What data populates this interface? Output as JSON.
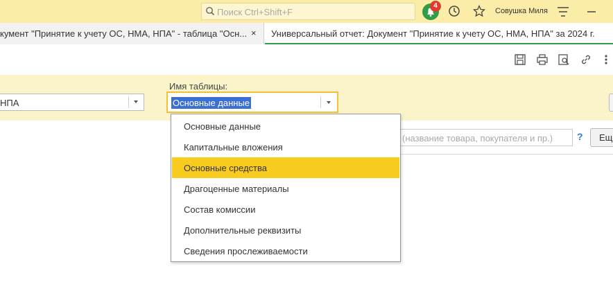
{
  "topbar": {
    "search_placeholder": "Поиск Ctrl+Shift+F",
    "notifications_count": "4",
    "user_name": "Совушка Миля"
  },
  "tabs": [
    {
      "label": "кумент \"Принятие к учету ОС, НМА, НПА\" - таблица \"Осн...",
      "close": "×"
    },
    {
      "label": "Универсальный отчет: Документ \"Принятие к учету ОС, НМА, НПА\" за 2024 г."
    }
  ],
  "filters": {
    "left_field_value": "НПА",
    "table_name_label": "Имя таблицы:",
    "table_name_value": "Основные данные"
  },
  "search": {
    "placeholder": "(название товара, покупателя и пр.)",
    "help": "?",
    "more_label": "Ещё"
  },
  "dropdown": {
    "items": [
      "Основные данные",
      "Капитальные вложения",
      "Основные средства",
      "Драгоценные материалы",
      "Состав комиссии",
      "Дополнительные реквизиты",
      "Сведения прослеживаемости"
    ],
    "highlighted": "Основные средства"
  },
  "colors": {
    "topbar": "#fbeda7",
    "panel": "#fbf3c9",
    "highlight": "#f8cb1f",
    "active_tab_underline": "#2e9d4c",
    "badge": "#e03b2e",
    "selection": "#3b6fd4"
  }
}
